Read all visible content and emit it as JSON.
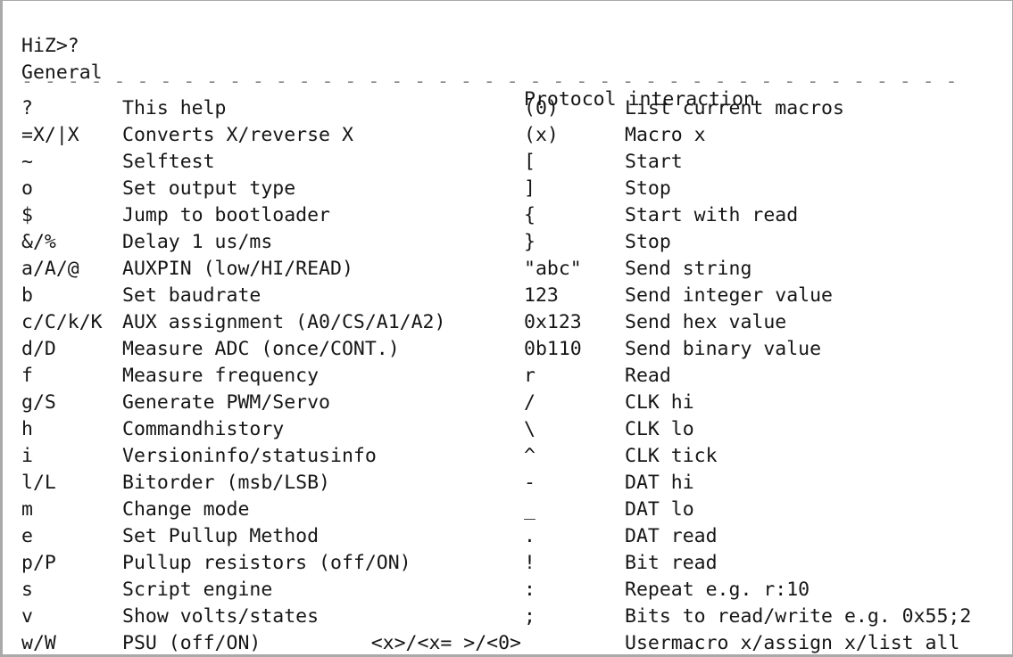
{
  "terminal": {
    "prompt_line": "HiZ>?",
    "columns": {
      "left_header": "General",
      "right_header": "Protocol interaction"
    },
    "separator": {
      "character": "-",
      "repeat": 69,
      "color": "#8d8d8d"
    },
    "colors": {
      "background": "#ffffff",
      "text": "#161616",
      "separator": "#8d8d8d",
      "frame": "#a9a9a9"
    },
    "left_rows": [
      {
        "key": "?",
        "desc": "This help"
      },
      {
        "key": "=X/|X",
        "desc": "Converts X/reverse X"
      },
      {
        "key": "~",
        "desc": "Selftest"
      },
      {
        "key": "o",
        "desc": "Set output type"
      },
      {
        "key": "$",
        "desc": "Jump to bootloader"
      },
      {
        "key": "&/%",
        "desc": "Delay 1 us/ms"
      },
      {
        "key": "a/A/@",
        "desc": "AUXPIN (low/HI/READ)"
      },
      {
        "key": "b",
        "desc": "Set baudrate"
      },
      {
        "key": "c/C/k/K",
        "desc": "AUX assignment (A0/CS/A1/A2)"
      },
      {
        "key": "d/D",
        "desc": "Measure ADC (once/CONT.)"
      },
      {
        "key": "f",
        "desc": "Measure frequency"
      },
      {
        "key": "g/S",
        "desc": "Generate PWM/Servo"
      },
      {
        "key": "h",
        "desc": "Commandhistory"
      },
      {
        "key": "i",
        "desc": "Versioninfo/statusinfo"
      },
      {
        "key": "l/L",
        "desc": "Bitorder (msb/LSB)"
      },
      {
        "key": "m",
        "desc": "Change mode"
      },
      {
        "key": "e",
        "desc": "Set Pullup Method"
      },
      {
        "key": "p/P",
        "desc": "Pullup resistors (off/ON)"
      },
      {
        "key": "s",
        "desc": "Script engine"
      },
      {
        "key": "v",
        "desc": "Show volts/states"
      },
      {
        "key": "w/W",
        "desc": "PSU (off/ON)"
      }
    ],
    "left_last_extra_key": "<x>/<x= >/<0>",
    "right_rows": [
      {
        "key": "(0)",
        "desc": "List current macros"
      },
      {
        "key": "(x)",
        "desc": "Macro x"
      },
      {
        "key": "[",
        "desc": "Start"
      },
      {
        "key": "]",
        "desc": "Stop"
      },
      {
        "key": "{",
        "desc": "Start with read"
      },
      {
        "key": "}",
        "desc": "Stop"
      },
      {
        "key": "\"abc\"",
        "desc": "Send string"
      },
      {
        "key": "123",
        "desc": "Send integer value"
      },
      {
        "key": "0x123",
        "desc": "Send hex value"
      },
      {
        "key": "0b110",
        "desc": "Send binary value"
      },
      {
        "key": "r",
        "desc": "Read"
      },
      {
        "key": "/",
        "desc": "CLK hi"
      },
      {
        "key": "\\",
        "desc": "CLK lo"
      },
      {
        "key": "^",
        "desc": "CLK tick"
      },
      {
        "key": "-",
        "desc": "DAT hi"
      },
      {
        "key": "_",
        "desc": "DAT lo"
      },
      {
        "key": ".",
        "desc": "DAT read"
      },
      {
        "key": "!",
        "desc": "Bit read"
      },
      {
        "key": ":",
        "desc": "Repeat e.g. r:10"
      },
      {
        "key": ";",
        "desc": "Bits to read/write e.g. 0x55;2"
      },
      {
        "key": "",
        "desc": "Usermacro x/assign x/list all"
      }
    ]
  }
}
